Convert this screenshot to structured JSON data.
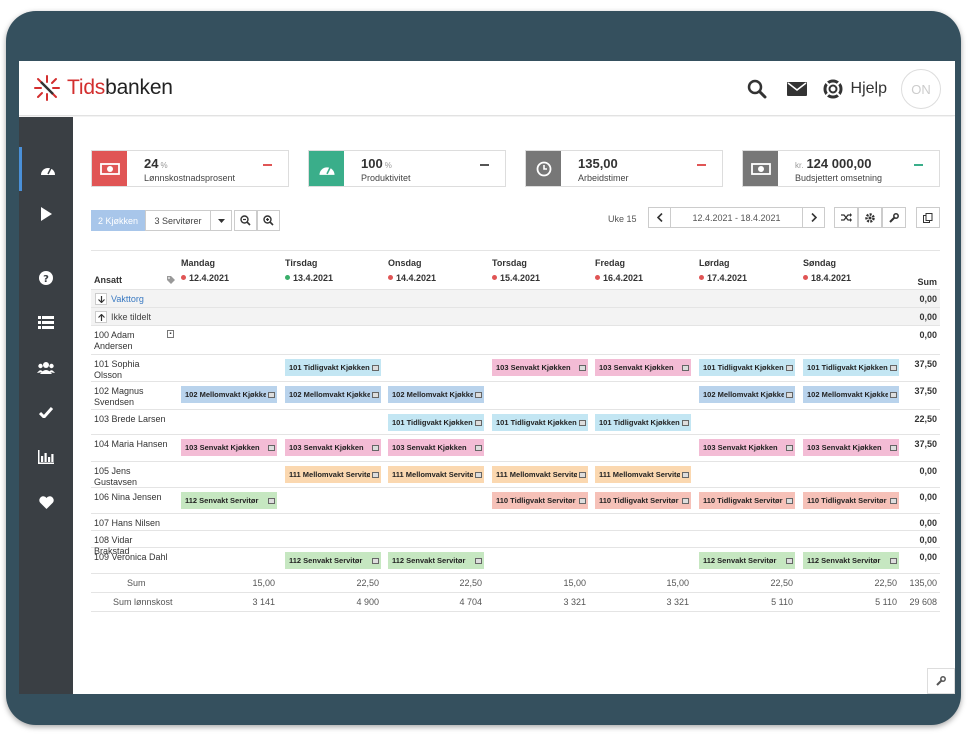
{
  "app": {
    "brand_prefix": "Tids",
    "brand_suffix": "banken",
    "help_label": "Hjelp",
    "on_label": "ON"
  },
  "colors": {
    "accent": "#4a90d9",
    "red": "#e05555",
    "green": "#3aae8a",
    "gray": "#777777",
    "frame": "#35505e",
    "sidebar": "#3a3f44"
  },
  "kpis": [
    {
      "value": "24",
      "unit": "%",
      "prefix": "",
      "label": "Lønnskostnadsprosent",
      "icon": "money-icon",
      "color": "#e05555",
      "trend_color": "#e05555"
    },
    {
      "value": "100",
      "unit": "%",
      "prefix": "",
      "label": "Produktivitet",
      "icon": "speedometer-icon",
      "color": "#3aae8a",
      "trend_color": "#555555"
    },
    {
      "value": "135,00",
      "unit": "",
      "prefix": "",
      "label": "Arbeidstimer",
      "icon": "clock-icon",
      "color": "#777777",
      "trend_color": "#e05555"
    },
    {
      "value": "124 000,00",
      "unit": "",
      "prefix": "kr.",
      "label": "Budsjettert omsetning",
      "icon": "money-icon",
      "color": "#777777",
      "trend_color": "#3aae8a"
    }
  ],
  "toolbar": {
    "tab1": "2 Kjøkken",
    "tab2": "3 Servitører",
    "week_label": "Uke 15",
    "date_range": "12.4.2021 - 18.4.2021"
  },
  "grid": {
    "header_employee": "Ansatt",
    "header_sum": "Sum",
    "days": [
      {
        "name": "Mandag",
        "date": "12.4.2021",
        "dot": "#e05555"
      },
      {
        "name": "Tirsdag",
        "date": "13.4.2021",
        "dot": "#3aae6a"
      },
      {
        "name": "Onsdag",
        "date": "14.4.2021",
        "dot": "#e05555"
      },
      {
        "name": "Torsdag",
        "date": "15.4.2021",
        "dot": "#e05555"
      },
      {
        "name": "Fredag",
        "date": "16.4.2021",
        "dot": "#e05555"
      },
      {
        "name": "Lørdag",
        "date": "17.4.2021",
        "dot": "#e05555"
      },
      {
        "name": "Søndag",
        "date": "18.4.2021",
        "dot": "#e05555"
      }
    ],
    "vakttorg": {
      "label": "Vakttorg",
      "sum": "0,00"
    },
    "ikke_tildelt": {
      "label": "Ikke tildelt",
      "sum": "0,00"
    },
    "employees": [
      {
        "name": "100 Adam Andersen",
        "sum": "0,00",
        "shifts": []
      },
      {
        "name": "101 Sophia Olsson",
        "sum": "37,50",
        "shifts": [
          {
            "day": 1,
            "label": "101 Tidligvakt Kjøkken",
            "cls": "s-cyan"
          },
          {
            "day": 3,
            "label": "103 Senvakt Kjøkken",
            "cls": "s-pink"
          },
          {
            "day": 4,
            "label": "103 Senvakt Kjøkken",
            "cls": "s-pink"
          },
          {
            "day": 5,
            "label": "101 Tidligvakt Kjøkken",
            "cls": "s-cyan"
          },
          {
            "day": 6,
            "label": "101 Tidligvakt Kjøkken",
            "cls": "s-cyan"
          }
        ]
      },
      {
        "name": "102 Magnus Svendsen",
        "sum": "37,50",
        "shifts": [
          {
            "day": 0,
            "label": "102 Mellomvakt Kjøkken",
            "cls": "s-blue"
          },
          {
            "day": 1,
            "label": "102 Mellomvakt Kjøkken",
            "cls": "s-blue"
          },
          {
            "day": 2,
            "label": "102 Mellomvakt Kjøkken",
            "cls": "s-blue"
          },
          {
            "day": 5,
            "label": "102 Mellomvakt Kjøkken",
            "cls": "s-blue"
          },
          {
            "day": 6,
            "label": "102 Mellomvakt Kjøkken",
            "cls": "s-blue"
          }
        ]
      },
      {
        "name": "103 Brede Larsen",
        "sum": "22,50",
        "shifts": [
          {
            "day": 2,
            "label": "101 Tidligvakt Kjøkken",
            "cls": "s-cyan"
          },
          {
            "day": 3,
            "label": "101 Tidligvakt Kjøkken",
            "cls": "s-cyan"
          },
          {
            "day": 4,
            "label": "101 Tidligvakt Kjøkken",
            "cls": "s-cyan"
          }
        ]
      },
      {
        "name": "104 Maria Hansen",
        "sum": "37,50",
        "shifts": [
          {
            "day": 0,
            "label": "103 Senvakt Kjøkken",
            "cls": "s-pink"
          },
          {
            "day": 1,
            "label": "103 Senvakt Kjøkken",
            "cls": "s-pink"
          },
          {
            "day": 2,
            "label": "103 Senvakt Kjøkken",
            "cls": "s-pink"
          },
          {
            "day": 5,
            "label": "103 Senvakt Kjøkken",
            "cls": "s-pink"
          },
          {
            "day": 6,
            "label": "103 Senvakt Kjøkken",
            "cls": "s-pink"
          }
        ]
      },
      {
        "name": "105 Jens Gustavsen",
        "sum": "0,00",
        "shifts": [
          {
            "day": 1,
            "label": "111 Mellomvakt Servitør",
            "cls": "s-orange"
          },
          {
            "day": 2,
            "label": "111 Mellomvakt Servitør",
            "cls": "s-orange"
          },
          {
            "day": 3,
            "label": "111 Mellomvakt Servitør",
            "cls": "s-orange"
          },
          {
            "day": 4,
            "label": "111 Mellomvakt Servitør",
            "cls": "s-orange"
          }
        ]
      },
      {
        "name": "106 Nina Jensen",
        "sum": "0,00",
        "shifts": [
          {
            "day": 0,
            "label": "112 Senvakt Servitør",
            "cls": "s-green"
          },
          {
            "day": 3,
            "label": "110 Tidligvakt Servitør",
            "cls": "s-salmon"
          },
          {
            "day": 4,
            "label": "110 Tidligvakt Servitør",
            "cls": "s-salmon"
          },
          {
            "day": 5,
            "label": "110 Tidligvakt Servitør",
            "cls": "s-salmon"
          },
          {
            "day": 6,
            "label": "110 Tidligvakt Servitør",
            "cls": "s-salmon"
          }
        ]
      },
      {
        "name": "107 Hans Nilsen",
        "sum": "0,00",
        "shifts": []
      },
      {
        "name": "108 Vidar Brakstad",
        "sum": "0,00",
        "shifts": []
      },
      {
        "name": "109 Veronica Dahl",
        "sum": "0,00",
        "shifts": [
          {
            "day": 1,
            "label": "112 Senvakt Servitør",
            "cls": "s-green"
          },
          {
            "day": 2,
            "label": "112 Senvakt Servitør",
            "cls": "s-green"
          },
          {
            "day": 5,
            "label": "112 Senvakt Servitør",
            "cls": "s-green"
          },
          {
            "day": 6,
            "label": "112 Senvakt Servitør",
            "cls": "s-green"
          }
        ]
      }
    ],
    "sum_row": {
      "label": "Sum",
      "values": [
        "15,00",
        "22,50",
        "22,50",
        "15,00",
        "15,00",
        "22,50",
        "22,50"
      ],
      "total": "135,00"
    },
    "cost_row": {
      "label": "Sum lønnskost",
      "values": [
        "3 141",
        "4 900",
        "4 704",
        "3 321",
        "3 321",
        "5 110",
        "5 110"
      ],
      "total": "29 608"
    }
  }
}
